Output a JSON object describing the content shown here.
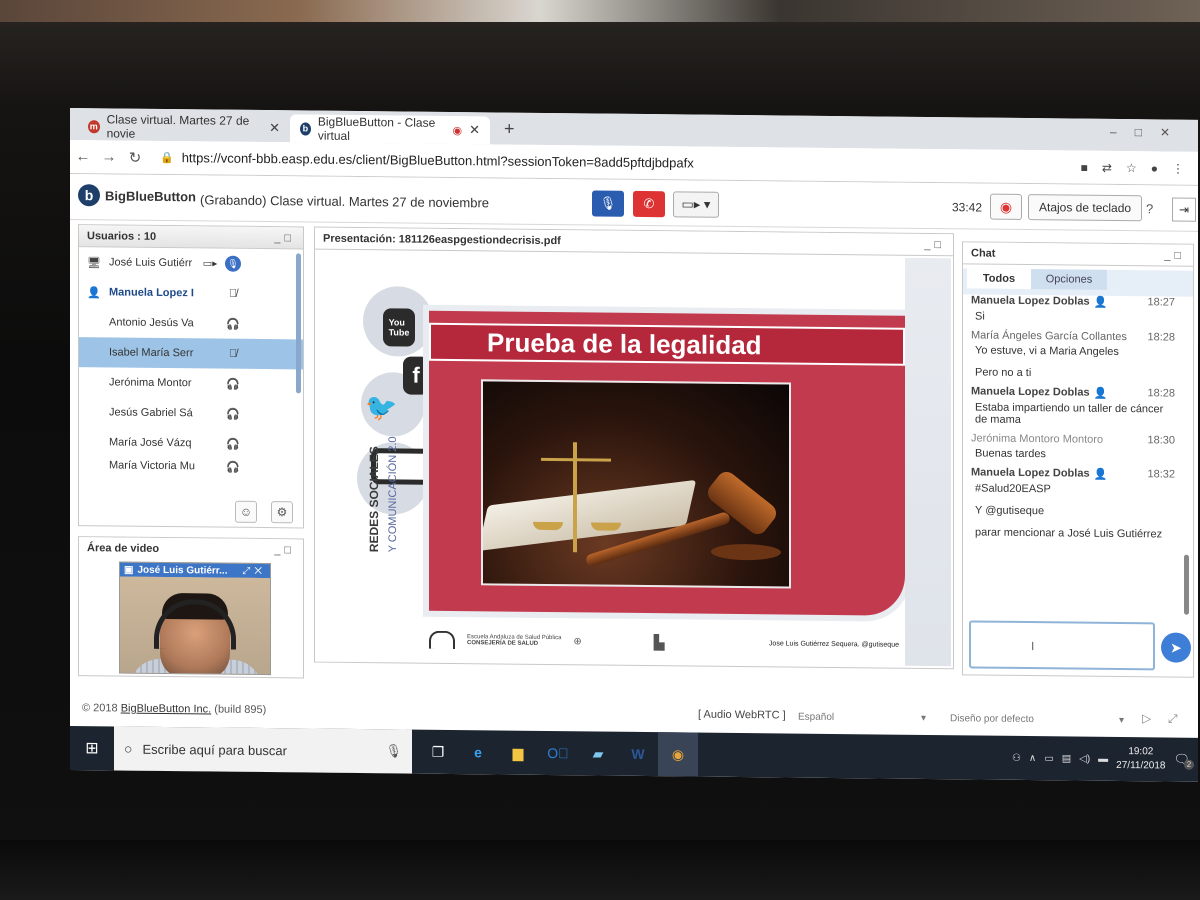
{
  "browser": {
    "tabs": [
      {
        "label": "Clase virtual. Martes 27 de novie"
      },
      {
        "label": "BigBlueButton - Clase virtual"
      }
    ],
    "url": "https://vconf-bbb.easp.edu.es/client/BigBlueButton.html?sessionToken=8add5pftdjbdpafx"
  },
  "header": {
    "app_name": "BigBlueButton",
    "title": "(Grabando) Clase virtual. Martes 27 de noviembre",
    "timer": "33:42",
    "shortcuts_label": "Atajos de teclado"
  },
  "users_panel": {
    "title": "Usuarios : 10",
    "users": [
      {
        "name": "José Luis Gutiérr"
      },
      {
        "name": "Manuela Lopez I"
      },
      {
        "name": "Antonio Jesús Va"
      },
      {
        "name": "Isabel María Serr"
      },
      {
        "name": "Jerónima Montor"
      },
      {
        "name": "Jesús Gabriel Sá"
      },
      {
        "name": "María José Vázq"
      },
      {
        "name": "María Victoria Mu"
      }
    ]
  },
  "video_panel": {
    "title": "Área de video",
    "participant": "José Luis Gutiérr..."
  },
  "presentation": {
    "title": "Presentación: 181126easpgestiondecrisis.pdf",
    "slide_title": "Prueba de la legalidad",
    "vertical_text_1": "REDES SOCIALES",
    "vertical_text_2": "Y COMUNICACIÓN 2.0",
    "footer_org1": "Escuela Andaluza de Salud Pública",
    "footer_org2": "CONSEJERÍA DE SALUD",
    "footer_author": "Jose Luis Gutiérrez Sequera. @gutiseque"
  },
  "chat": {
    "title": "Chat",
    "tab_all": "Todos",
    "tab_options": "Opciones",
    "messages": [
      {
        "sender": "Manuela Lopez Doblas",
        "time": "18:27",
        "lines": [
          "Si"
        ]
      },
      {
        "sender": "María Ángeles García Collantes",
        "time": "18:28",
        "lines": [
          "Yo estuve, vi a Maria Angeles",
          "Pero no a ti"
        ]
      },
      {
        "sender": "Manuela Lopez Doblas",
        "time": "18:28",
        "lines": [
          "Estaba impartiendo un taller de cáncer de mama"
        ]
      },
      {
        "sender": "Jerónima Montoro Montoro",
        "time": "18:30",
        "lines": [
          "Buenas tardes"
        ]
      },
      {
        "sender": "Manuela Lopez Doblas",
        "time": "18:32",
        "lines": [
          "#Salud20EASP",
          "Y @gutiseque",
          "parar mencionar a José Luis Gutiérrez"
        ]
      }
    ]
  },
  "footer": {
    "copyright_prefix": "© 2018",
    "copyright_link": "BigBlueButton Inc.",
    "build": "(build 895)",
    "audio": "[ Audio WebRTC ]",
    "language": "Español",
    "layout": "Diseño por defecto"
  },
  "taskbar": {
    "search_placeholder": "Escribe aquí para buscar",
    "time": "19:02",
    "date": "27/11/2018",
    "notifications": "2"
  }
}
